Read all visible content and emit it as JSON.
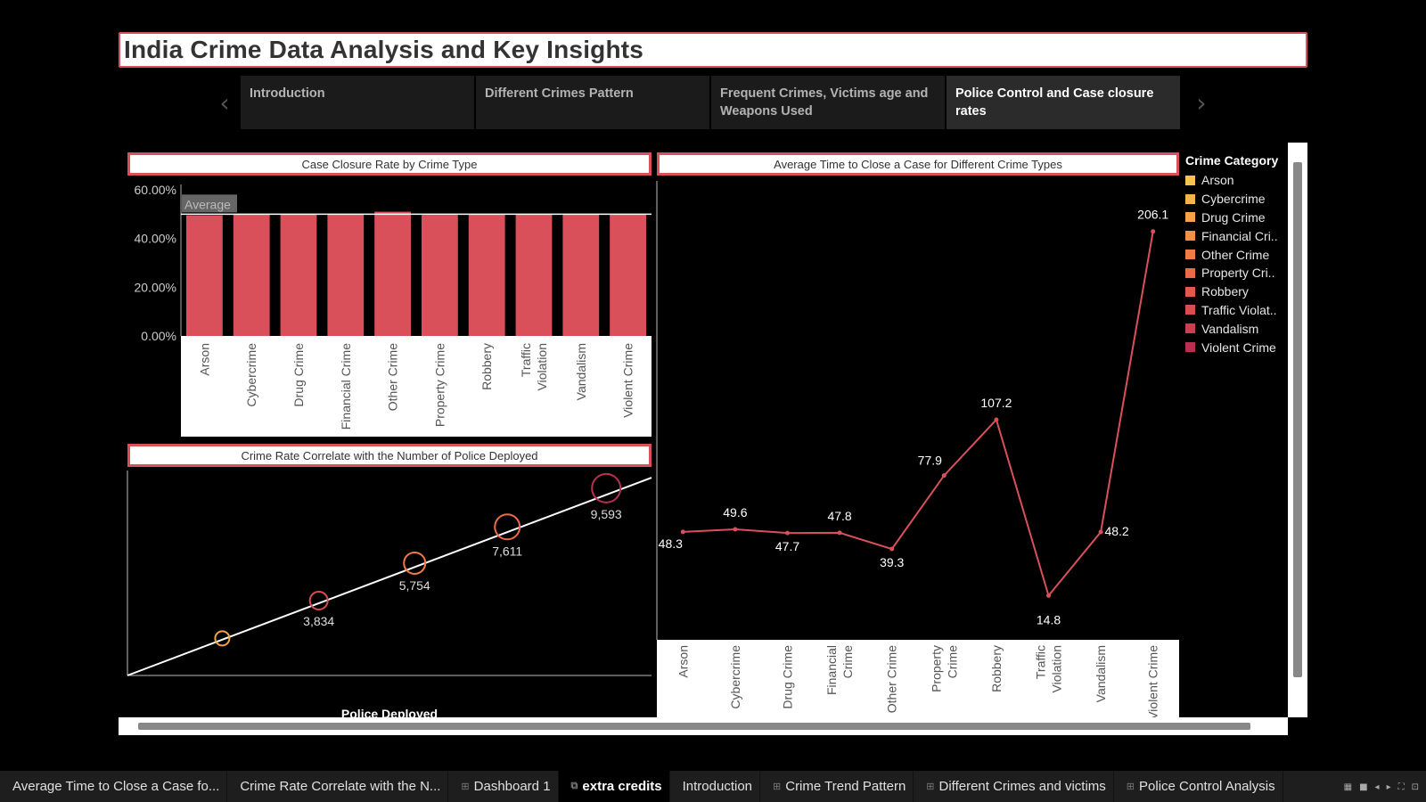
{
  "title": "India Crime Data Analysis and Key Insights",
  "story_points": [
    {
      "label": "Introduction",
      "active": false
    },
    {
      "label": "Different Crimes Pattern",
      "active": false
    },
    {
      "label": "Frequent Crimes, Victims age and Weapons Used",
      "active": false
    },
    {
      "label": "Police Control and Case closure rates",
      "active": true
    }
  ],
  "panels": {
    "closure_title": "Case Closure Rate by Crime Type",
    "avg_time_title": "Average Time to Close a Case for Different Crime Types",
    "police_title": "Crime Rate Correlate with the Number of Police Deployed"
  },
  "legend": {
    "title": "Crime Category",
    "items": [
      {
        "label": "Arson",
        "color": "#f5c44e"
      },
      {
        "label": "Cybercrime",
        "color": "#f7b44a"
      },
      {
        "label": "Drug Crime",
        "color": "#f5a248"
      },
      {
        "label": "Financial Cri..",
        "color": "#f38e45"
      },
      {
        "label": "Other Crime",
        "color": "#ef7b46"
      },
      {
        "label": "Property Cri..",
        "color": "#eb6a4a"
      },
      {
        "label": "Robbery",
        "color": "#e35a4c"
      },
      {
        "label": "Traffic Violat..",
        "color": "#d94d4f"
      },
      {
        "label": "Vandalism",
        "color": "#cc3f50"
      },
      {
        "label": "Violent Crime",
        "color": "#b92f52"
      }
    ]
  },
  "chart_data": [
    {
      "type": "bar",
      "title": "Case Closure Rate by Crime Type",
      "categories": [
        "Arson",
        "Cybercrime",
        "Drug Crime",
        "Financial Crime",
        "Other Crime",
        "Property Crime",
        "Robbery",
        "Traffic Violation",
        "Vandalism",
        "Violent Crime"
      ],
      "values": [
        49.5,
        50.0,
        49.8,
        49.9,
        51.0,
        49.7,
        49.9,
        50.0,
        50.0,
        49.9
      ],
      "ylim": [
        0,
        60
      ],
      "yticks": [
        "0.00%",
        "20.00%",
        "40.00%",
        "60.00%"
      ],
      "ytick_values": [
        0,
        20,
        40,
        60
      ],
      "reference_line": {
        "label": "Average",
        "value": 50.0
      },
      "color": "#d9505a"
    },
    {
      "type": "line",
      "title": "Average Time to Close a Case for Different Crime Types",
      "categories": [
        "Arson",
        "Cybercrime",
        "Drug Crime",
        "Financial Crime",
        "Other Crime",
        "Property Crime",
        "Robbery",
        "Traffic Violation",
        "Vandalism",
        "Violent Crime"
      ],
      "values": [
        48.3,
        49.6,
        47.7,
        47.8,
        39.3,
        77.9,
        107.2,
        14.8,
        48.2,
        206.1
      ],
      "labels": [
        "48.3",
        "49.6",
        "47.7",
        "47.8",
        "39.3",
        "77.9",
        "107.2",
        "14.8",
        "48.2",
        "206.1"
      ],
      "ylim": [
        0,
        220
      ],
      "color": "#d9505a"
    },
    {
      "type": "scatter",
      "title": "Crime Rate Correlate with the Number of Police Deployed",
      "xlabel": "Police Deployed",
      "points": [
        {
          "x": 1900,
          "y": 1900,
          "label": "",
          "color": "#f5a248",
          "r": 8
        },
        {
          "x": 3834,
          "y": 3834,
          "label": "3,834",
          "color": "#d94d4f",
          "r": 10
        },
        {
          "x": 5754,
          "y": 5754,
          "label": "5,754",
          "color": "#ef7b46",
          "r": 12
        },
        {
          "x": 7611,
          "y": 7611,
          "label": "7,611",
          "color": "#eb6a4a",
          "r": 14
        },
        {
          "x": 9593,
          "y": 9593,
          "label": "9,593",
          "color": "#b92f52",
          "r": 16
        }
      ],
      "xlim": [
        0,
        10500
      ],
      "ylim": [
        0,
        10500
      ],
      "trend_line": true
    }
  ],
  "bottom_tabs": [
    {
      "label": "Average Time to Close a Case fo...",
      "icon": "",
      "active": false
    },
    {
      "label": "Crime Rate Correlate with the N...",
      "icon": "",
      "active": false
    },
    {
      "label": "Dashboard 1",
      "icon": "⊞",
      "active": false
    },
    {
      "label": "extra credits",
      "icon": "⧉",
      "active": true
    },
    {
      "label": "Introduction",
      "icon": "",
      "active": false
    },
    {
      "label": "Crime Trend Pattern",
      "icon": "⊞",
      "active": false
    },
    {
      "label": "Different Crimes and victims",
      "icon": "⊞",
      "active": false
    },
    {
      "label": "Police Control Analysis",
      "icon": "⊞",
      "active": false
    }
  ],
  "icons": {
    "prev": "‹",
    "next": "›"
  }
}
